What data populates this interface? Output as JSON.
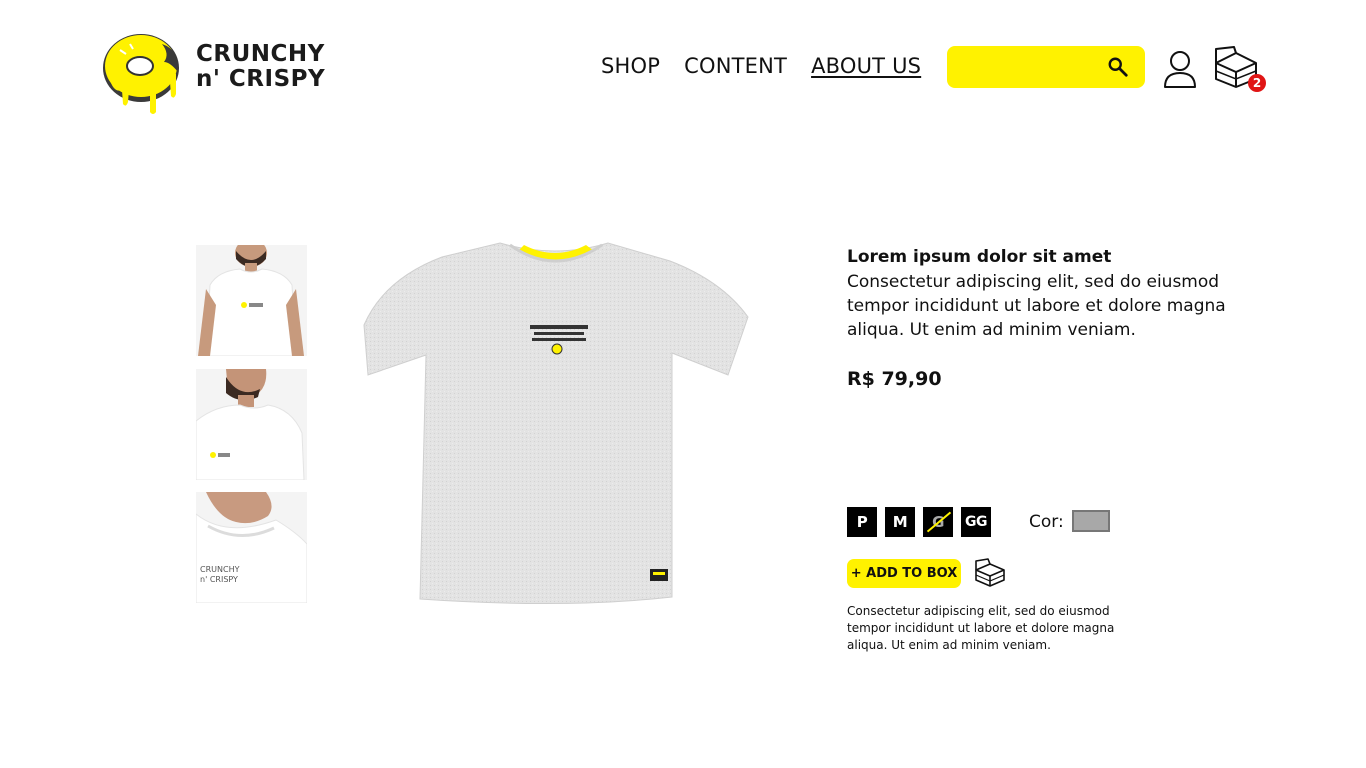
{
  "brand": {
    "line1": "CRUNCHY",
    "line2": "n' CRISPY",
    "accent": "#fff200",
    "logo_icon": "melting-donut-icon"
  },
  "nav": {
    "items": [
      {
        "label": "SHOP",
        "active": false
      },
      {
        "label": "CONTENT",
        "active": false
      },
      {
        "label": "ABOUT US",
        "active": true
      }
    ]
  },
  "search": {
    "value": "",
    "placeholder": "",
    "icon": "search-icon"
  },
  "header_icons": {
    "user": "user-icon",
    "cart": "box-cart-icon",
    "cart_count": "2",
    "badge_color": "#e01515"
  },
  "gallery": {
    "thumbnails": [
      "thumbnail-front",
      "thumbnail-side",
      "thumbnail-detail"
    ],
    "main_image": "grey-tshirt-product-image"
  },
  "product": {
    "title": "Lorem ipsum dolor sit amet",
    "description": "Consectetur adipiscing elit, sed do eiusmod tempor incididunt ut labore et dolore magna aliqua. Ut enim ad minim veniam.",
    "price": "R$ 79,90",
    "sizes": [
      {
        "label": "P",
        "available": true
      },
      {
        "label": "M",
        "available": true
      },
      {
        "label": "G",
        "available": false
      },
      {
        "label": "GG",
        "available": true
      }
    ],
    "color_label": "Cor:",
    "color_value": "#a8a8a8",
    "add_button": "+ ADD TO BOX",
    "note": "Consectetur adipiscing elit, sed do eiusmod tempor incididunt ut labore et dolore magna aliqua. Ut enim ad minim veniam."
  }
}
